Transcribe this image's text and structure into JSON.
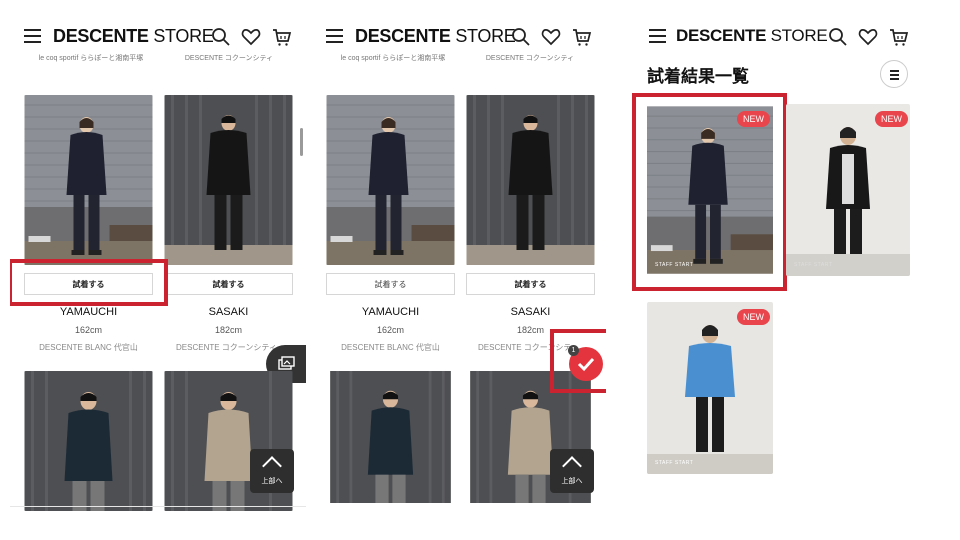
{
  "header": {
    "brand_bold": "DESCENTE",
    "brand_light": "STORE"
  },
  "grid_top_subtitles": {
    "left": "le coq sportif ららぽーと湘南平塚",
    "right": "DESCENTE コクーンシティ"
  },
  "cards": [
    {
      "try_label": "試着する",
      "name": "YAMAUCHI",
      "height": "162cm",
      "shop": "DESCENTE BLANC 代官山"
    },
    {
      "try_label": "試着する",
      "name": "SASAKI",
      "height": "182cm",
      "shop": "DESCENTE コクーンシティ"
    }
  ],
  "back_to_top": "上部へ",
  "selected_count": "1",
  "results": {
    "title": "試着結果一覧",
    "badge": "NEW",
    "watermark": "STAFF START"
  },
  "colors": {
    "accent_red": "#cc2330",
    "badge_red": "#e8454d",
    "dark_button": "#2e2e2e"
  },
  "icons": [
    "menu-icon",
    "search-icon",
    "heart-icon",
    "cart-icon",
    "chevron-up-icon",
    "check-icon",
    "gallery-icon",
    "filter-icon"
  ]
}
